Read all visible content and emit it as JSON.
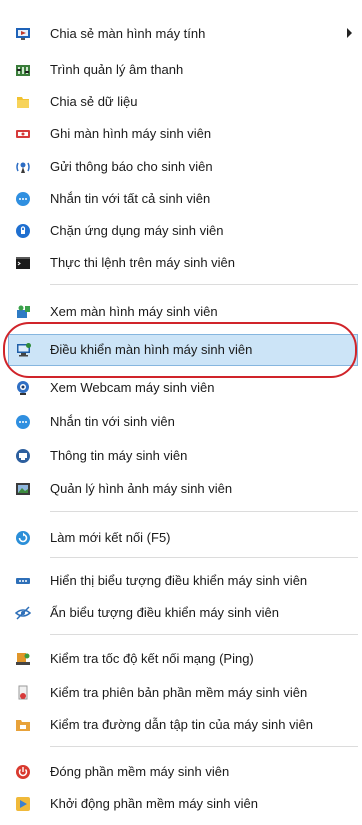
{
  "menu": {
    "items": [
      {
        "label": "Chia sẻ màn hình máy tính",
        "icon": "screen-share-icon",
        "has_submenu": true
      },
      {
        "label": "Trình quản lý âm thanh",
        "icon": "audio-mixer-icon"
      },
      {
        "label": "Chia sẻ dữ liệu",
        "icon": "folder-icon"
      },
      {
        "label": "Ghi màn hình máy sinh viên",
        "icon": "record-screen-icon"
      },
      {
        "label": "Gửi thông báo cho sinh viên",
        "icon": "broadcast-icon"
      },
      {
        "label": "Nhắn tin với tất cả sinh viên",
        "icon": "chat-all-icon"
      },
      {
        "label": "Chặn ứng dụng máy sinh viên",
        "icon": "block-app-icon"
      },
      {
        "label": "Thực thi lệnh trên máy sinh viên",
        "icon": "command-prompt-icon"
      },
      {
        "label": "Xem màn hình máy sinh viên",
        "icon": "view-screen-icon"
      },
      {
        "label": "Điều khiển màn hình máy sinh viên",
        "icon": "remote-control-icon",
        "selected": true
      },
      {
        "label": "Xem Webcam máy sinh viên",
        "icon": "webcam-icon"
      },
      {
        "label": "Nhắn tin với sinh viên",
        "icon": "chat-icon"
      },
      {
        "label": "Thông tin máy sinh viên",
        "icon": "computer-info-icon"
      },
      {
        "label": "Quản lý hình ảnh máy sinh viên",
        "icon": "image-manager-icon"
      },
      {
        "label": "Làm mới kết nối (F5)",
        "icon": "refresh-icon"
      },
      {
        "label": "Hiển thị biểu tượng điều khiển máy sinh viên",
        "icon": "show-control-icon"
      },
      {
        "label": "Ẩn biểu tượng điều khiển máy sinh viên",
        "icon": "hide-control-icon"
      },
      {
        "label": "Kiểm tra tốc độ kết nối mạng (Ping)",
        "icon": "ping-icon"
      },
      {
        "label": "Kiểm tra phiên bản phần mềm máy sinh viên",
        "icon": "version-check-icon"
      },
      {
        "label": "Kiểm tra đường dẫn tập tin của máy sinh viên",
        "icon": "path-check-icon"
      },
      {
        "label": "Đóng phần mềm máy sinh viên",
        "icon": "power-off-icon"
      },
      {
        "label": "Khởi động phần mềm máy sinh viên",
        "icon": "start-app-icon"
      }
    ]
  },
  "colors": {
    "selection_bg": "#cce4f7",
    "selection_border": "#86b6df",
    "annotation_ring": "#d0242a"
  }
}
